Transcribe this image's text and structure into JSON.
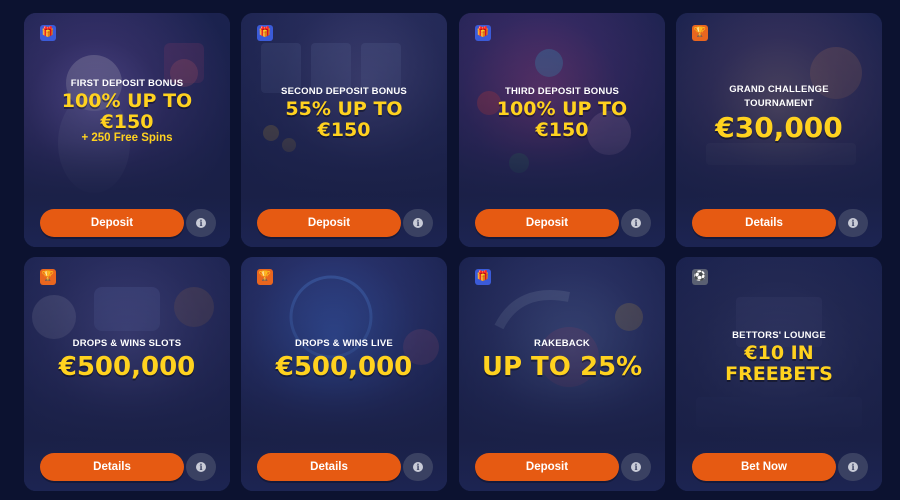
{
  "info_glyph": "i",
  "cards": [
    {
      "badge_icon": "gift-icon",
      "subtitle": "FIRST DEPOSIT BONUS",
      "headline_1": "100% UP TO",
      "headline_2": "€150",
      "extra": "+ 250 Free Spins",
      "button": "Deposit"
    },
    {
      "badge_icon": "gift-icon",
      "subtitle": "SECOND DEPOSIT BONUS",
      "headline_1": "55% UP TO",
      "headline_2": "€150",
      "button": "Deposit"
    },
    {
      "badge_icon": "gift-icon",
      "subtitle": "THIRD DEPOSIT BONUS",
      "headline_1": "100% UP TO",
      "headline_2": "€150",
      "button": "Deposit"
    },
    {
      "badge_icon": "trophy-icon",
      "subtitle_1": "GRAND CHALLENGE",
      "subtitle_2": "TOURNAMENT",
      "headline_1": "€30,000",
      "button": "Details"
    },
    {
      "badge_icon": "trophy-icon",
      "subtitle": "DROPS & WINS SLOTS",
      "headline_1": "€500,000",
      "button": "Details"
    },
    {
      "badge_icon": "trophy-icon",
      "subtitle": "DROPS & WINS LIVE",
      "headline_1": "€500,000",
      "button": "Details"
    },
    {
      "badge_icon": "gift-icon",
      "subtitle": "RAKEBACK",
      "headline_1": "UP TO 25%",
      "button": "Deposit"
    },
    {
      "badge_icon": "soccer-ball-icon",
      "subtitle": "BETTORS' LOUNGE",
      "headline_1": "€10 IN",
      "headline_2": "FREEBETS",
      "button": "Bet Now"
    }
  ]
}
